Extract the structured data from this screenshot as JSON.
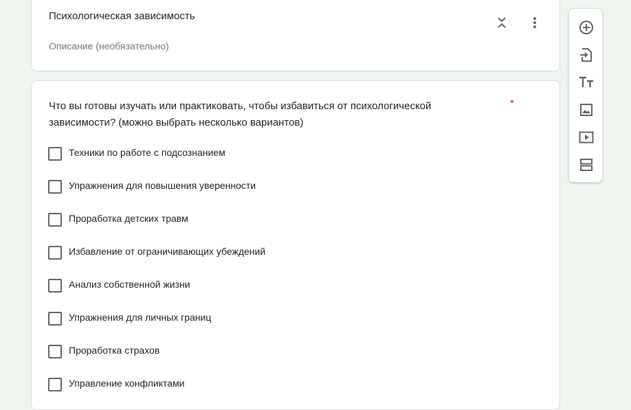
{
  "section": {
    "title": "Психологическая зависимость",
    "description_placeholder": "Описание (необязательно)"
  },
  "question": {
    "title": "Что вы готовы изучать или практиковать, чтобы избавиться от психологической зависимости? (можно выбрать несколько вариантов)",
    "required_mark": "*",
    "options": [
      "Техники по работе с подсознанием",
      "Упражнения для повышения уверенности",
      "Проработка детских травм",
      "Избавление от ограничивающих убеждений",
      "Анализ собственной жизни",
      "Упражнения для личных границ",
      "Проработка страхов",
      "Управление конфликтами"
    ]
  },
  "toolbar": {
    "items": [
      "add-question-icon",
      "import-questions-icon",
      "add-title-icon",
      "add-image-icon",
      "add-video-icon",
      "add-section-icon"
    ]
  },
  "colors": {
    "background": "#f0f4ef",
    "required": "#d93025",
    "icon": "#5f6368"
  }
}
